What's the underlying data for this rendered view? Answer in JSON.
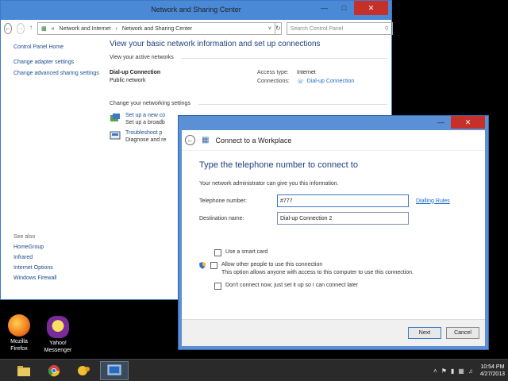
{
  "desktop": {
    "icons": [
      {
        "label_line1": "Mozilla",
        "label_line2": "Firefox"
      },
      {
        "label_line1": "Yahoo!",
        "label_line2": "Messenger"
      }
    ]
  },
  "nsc": {
    "title": "Network and Sharing Center",
    "breadcrumb": [
      "Network and Internet",
      "Network and Sharing Center"
    ],
    "search_placeholder": "Search Control Panel",
    "left_links": [
      "Control Panel Home",
      "Change adapter settings",
      "Change advanced sharing settings"
    ],
    "see_also_header": "See also",
    "see_also": [
      "HomeGroup",
      "Infrared",
      "Internet Options",
      "Windows Firewall"
    ],
    "main_heading": "View your basic network information and set up connections",
    "active_networks_header": "View your active networks",
    "network": {
      "name": "Dial-up Connection",
      "type": "Public network",
      "access_type_label": "Access type:",
      "access_type_value": "Internet",
      "connections_label": "Connections:",
      "connections_value": "Dial-up Connection"
    },
    "change_settings_header": "Change your networking settings",
    "tasks": [
      {
        "link": "Set up a new co",
        "desc": "Set up a broadb"
      },
      {
        "link": "Troubleshoot p",
        "desc": "Diagnose and re"
      }
    ]
  },
  "dialog": {
    "title": "Connect to a Workplace",
    "heading": "Type the telephone number to connect to",
    "info": "Your network administrator can give you this information.",
    "phone_label": "Telephone number:",
    "phone_value": "#777",
    "dialing_rules": "Dialling Rules",
    "dest_label": "Destination name:",
    "dest_value": "Dial-up Connection 2",
    "checkboxes": {
      "smart_card": "Use a smart card",
      "allow_others": "Allow other people to use this connection",
      "allow_others_desc": "This option allows anyone with access to this computer to use this connection.",
      "dont_connect": "Don't connect now; just set it up so I can connect later"
    },
    "next": "Next",
    "cancel": "Cancel"
  },
  "taskbar": {
    "time": "10:54 PM",
    "date": "4/27/2013"
  },
  "colors": {
    "accent": "#4a89d6",
    "link": "#1a4c8a",
    "heading": "#1e3f80",
    "close": "#c7302a"
  }
}
